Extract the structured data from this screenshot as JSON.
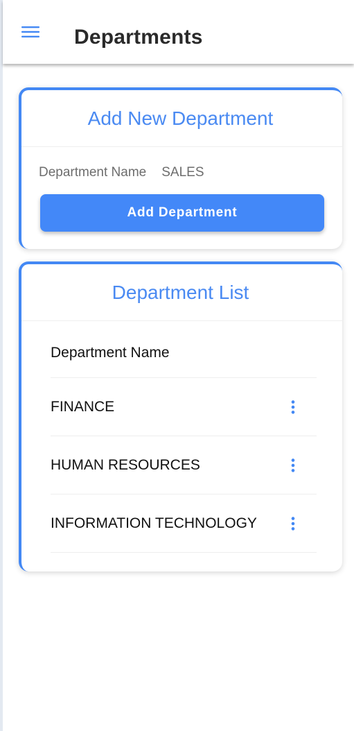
{
  "header": {
    "title": "Departments",
    "menu_icon": "hamburger-menu-icon"
  },
  "add_card": {
    "title": "Add New Department",
    "field_label": "Department Name",
    "field_value": "SALES",
    "button_label": "Add Department"
  },
  "list_card": {
    "title": "Department List",
    "column_header": "Department Name",
    "rows": [
      {
        "name": "FINANCE",
        "action_icon": "more-vert-icon"
      },
      {
        "name": "HUMAN RESOURCES",
        "action_icon": "more-vert-icon"
      },
      {
        "name": "INFORMATION TECHNOLOGY",
        "action_icon": "more-vert-icon"
      }
    ]
  },
  "colors": {
    "accent": "#4388f4",
    "title_text": "#2a2a2a",
    "muted_text": "#6d6d6d"
  }
}
